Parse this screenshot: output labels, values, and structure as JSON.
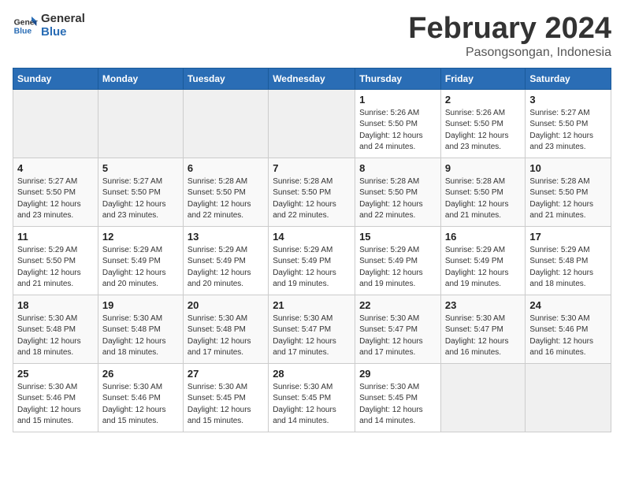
{
  "logo": {
    "line1": "General",
    "line2": "Blue"
  },
  "title": "February 2024",
  "subtitle": "Pasongsongan, Indonesia",
  "headers": [
    "Sunday",
    "Monday",
    "Tuesday",
    "Wednesday",
    "Thursday",
    "Friday",
    "Saturday"
  ],
  "weeks": [
    [
      {
        "day": "",
        "info": ""
      },
      {
        "day": "",
        "info": ""
      },
      {
        "day": "",
        "info": ""
      },
      {
        "day": "",
        "info": ""
      },
      {
        "day": "1",
        "info": "Sunrise: 5:26 AM\nSunset: 5:50 PM\nDaylight: 12 hours\nand 24 minutes."
      },
      {
        "day": "2",
        "info": "Sunrise: 5:26 AM\nSunset: 5:50 PM\nDaylight: 12 hours\nand 23 minutes."
      },
      {
        "day": "3",
        "info": "Sunrise: 5:27 AM\nSunset: 5:50 PM\nDaylight: 12 hours\nand 23 minutes."
      }
    ],
    [
      {
        "day": "4",
        "info": "Sunrise: 5:27 AM\nSunset: 5:50 PM\nDaylight: 12 hours\nand 23 minutes."
      },
      {
        "day": "5",
        "info": "Sunrise: 5:27 AM\nSunset: 5:50 PM\nDaylight: 12 hours\nand 23 minutes."
      },
      {
        "day": "6",
        "info": "Sunrise: 5:28 AM\nSunset: 5:50 PM\nDaylight: 12 hours\nand 22 minutes."
      },
      {
        "day": "7",
        "info": "Sunrise: 5:28 AM\nSunset: 5:50 PM\nDaylight: 12 hours\nand 22 minutes."
      },
      {
        "day": "8",
        "info": "Sunrise: 5:28 AM\nSunset: 5:50 PM\nDaylight: 12 hours\nand 22 minutes."
      },
      {
        "day": "9",
        "info": "Sunrise: 5:28 AM\nSunset: 5:50 PM\nDaylight: 12 hours\nand 21 minutes."
      },
      {
        "day": "10",
        "info": "Sunrise: 5:28 AM\nSunset: 5:50 PM\nDaylight: 12 hours\nand 21 minutes."
      }
    ],
    [
      {
        "day": "11",
        "info": "Sunrise: 5:29 AM\nSunset: 5:50 PM\nDaylight: 12 hours\nand 21 minutes."
      },
      {
        "day": "12",
        "info": "Sunrise: 5:29 AM\nSunset: 5:49 PM\nDaylight: 12 hours\nand 20 minutes."
      },
      {
        "day": "13",
        "info": "Sunrise: 5:29 AM\nSunset: 5:49 PM\nDaylight: 12 hours\nand 20 minutes."
      },
      {
        "day": "14",
        "info": "Sunrise: 5:29 AM\nSunset: 5:49 PM\nDaylight: 12 hours\nand 19 minutes."
      },
      {
        "day": "15",
        "info": "Sunrise: 5:29 AM\nSunset: 5:49 PM\nDaylight: 12 hours\nand 19 minutes."
      },
      {
        "day": "16",
        "info": "Sunrise: 5:29 AM\nSunset: 5:49 PM\nDaylight: 12 hours\nand 19 minutes."
      },
      {
        "day": "17",
        "info": "Sunrise: 5:29 AM\nSunset: 5:48 PM\nDaylight: 12 hours\nand 18 minutes."
      }
    ],
    [
      {
        "day": "18",
        "info": "Sunrise: 5:30 AM\nSunset: 5:48 PM\nDaylight: 12 hours\nand 18 minutes."
      },
      {
        "day": "19",
        "info": "Sunrise: 5:30 AM\nSunset: 5:48 PM\nDaylight: 12 hours\nand 18 minutes."
      },
      {
        "day": "20",
        "info": "Sunrise: 5:30 AM\nSunset: 5:48 PM\nDaylight: 12 hours\nand 17 minutes."
      },
      {
        "day": "21",
        "info": "Sunrise: 5:30 AM\nSunset: 5:47 PM\nDaylight: 12 hours\nand 17 minutes."
      },
      {
        "day": "22",
        "info": "Sunrise: 5:30 AM\nSunset: 5:47 PM\nDaylight: 12 hours\nand 17 minutes."
      },
      {
        "day": "23",
        "info": "Sunrise: 5:30 AM\nSunset: 5:47 PM\nDaylight: 12 hours\nand 16 minutes."
      },
      {
        "day": "24",
        "info": "Sunrise: 5:30 AM\nSunset: 5:46 PM\nDaylight: 12 hours\nand 16 minutes."
      }
    ],
    [
      {
        "day": "25",
        "info": "Sunrise: 5:30 AM\nSunset: 5:46 PM\nDaylight: 12 hours\nand 15 minutes."
      },
      {
        "day": "26",
        "info": "Sunrise: 5:30 AM\nSunset: 5:46 PM\nDaylight: 12 hours\nand 15 minutes."
      },
      {
        "day": "27",
        "info": "Sunrise: 5:30 AM\nSunset: 5:45 PM\nDaylight: 12 hours\nand 15 minutes."
      },
      {
        "day": "28",
        "info": "Sunrise: 5:30 AM\nSunset: 5:45 PM\nDaylight: 12 hours\nand 14 minutes."
      },
      {
        "day": "29",
        "info": "Sunrise: 5:30 AM\nSunset: 5:45 PM\nDaylight: 12 hours\nand 14 minutes."
      },
      {
        "day": "",
        "info": ""
      },
      {
        "day": "",
        "info": ""
      }
    ]
  ]
}
